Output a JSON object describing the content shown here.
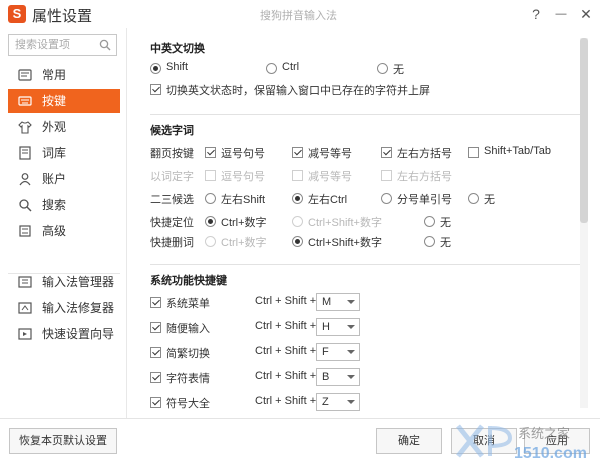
{
  "window": {
    "title": "属性设置",
    "center_title": "搜狗拼音输入法",
    "logo_letter": "S",
    "help_label": "?",
    "minimize_label": "—",
    "close_label": "✕"
  },
  "sidebar": {
    "search_placeholder": "搜索设置项",
    "items": [
      {
        "label": "常用",
        "icon": "gear-icon"
      },
      {
        "label": "按键",
        "icon": "keyboard-icon"
      },
      {
        "label": "外观",
        "icon": "shirt-icon"
      },
      {
        "label": "词库",
        "icon": "book-icon"
      },
      {
        "label": "账户",
        "icon": "user-icon"
      },
      {
        "label": "搜索",
        "icon": "search-icon"
      },
      {
        "label": "高级",
        "icon": "advanced-icon"
      }
    ],
    "tools": [
      {
        "label": "输入法管理器",
        "icon": "manager-icon"
      },
      {
        "label": "输入法修复器",
        "icon": "repair-icon"
      },
      {
        "label": "快速设置向导",
        "icon": "wizard-icon"
      }
    ],
    "active_index": 1
  },
  "sections": {
    "cn_en": {
      "title": "中英文切换",
      "options": [
        "Shift",
        "Ctrl",
        "无"
      ],
      "selected": "Shift",
      "commit_checkbox": "切换英文状态时，保留输入窗口中已存在的字符并上屏",
      "commit_checked": true
    },
    "candidate": {
      "title": "候选字词",
      "page_label": "翻页按键",
      "page_options": [
        {
          "label": "逗号句号",
          "checked": true
        },
        {
          "label": "减号等号",
          "checked": true
        },
        {
          "label": "左右方括号",
          "checked": true
        },
        {
          "label": "Shift+Tab/Tab",
          "checked": false
        }
      ],
      "word_label": "以词定字",
      "word_options": [
        {
          "label": "逗号句号",
          "checked": false
        },
        {
          "label": "减号等号",
          "checked": false
        },
        {
          "label": "左右方括号",
          "checked": false
        }
      ],
      "second_third_label": "二三候选",
      "second_third_options": [
        "左右Shift",
        "左右Ctrl",
        "分号单引号",
        "无"
      ],
      "second_third_selected": "左右Ctrl",
      "quick_pos_label": "快捷定位",
      "quick_pos_options": [
        "Ctrl+数字",
        "Ctrl+Shift+数字",
        "无"
      ],
      "quick_pos_selected": "Ctrl+数字",
      "quick_del_label": "快捷删词",
      "quick_del_options": [
        "Ctrl+数字",
        "Ctrl+Shift+数字",
        "无"
      ],
      "quick_del_selected": "Ctrl+Shift+数字"
    },
    "shortcuts": {
      "title": "系统功能快捷键",
      "prefix": "Ctrl + Shift +",
      "items": [
        {
          "label": "系统菜单",
          "key": "M",
          "checked": true
        },
        {
          "label": "随便输入",
          "key": "H",
          "checked": true
        },
        {
          "label": "简繁切换",
          "key": "F",
          "checked": true
        },
        {
          "label": "字符表情",
          "key": "B",
          "checked": true
        },
        {
          "label": "符号大全",
          "key": "Z",
          "checked": true
        }
      ]
    }
  },
  "footer": {
    "restore_label": "恢复本页默认设置",
    "ok_label": "确定",
    "cancel_label": "取消",
    "apply_label": "应用"
  },
  "colors": {
    "accent": "#f0641e",
    "logo": "#e8541e"
  }
}
